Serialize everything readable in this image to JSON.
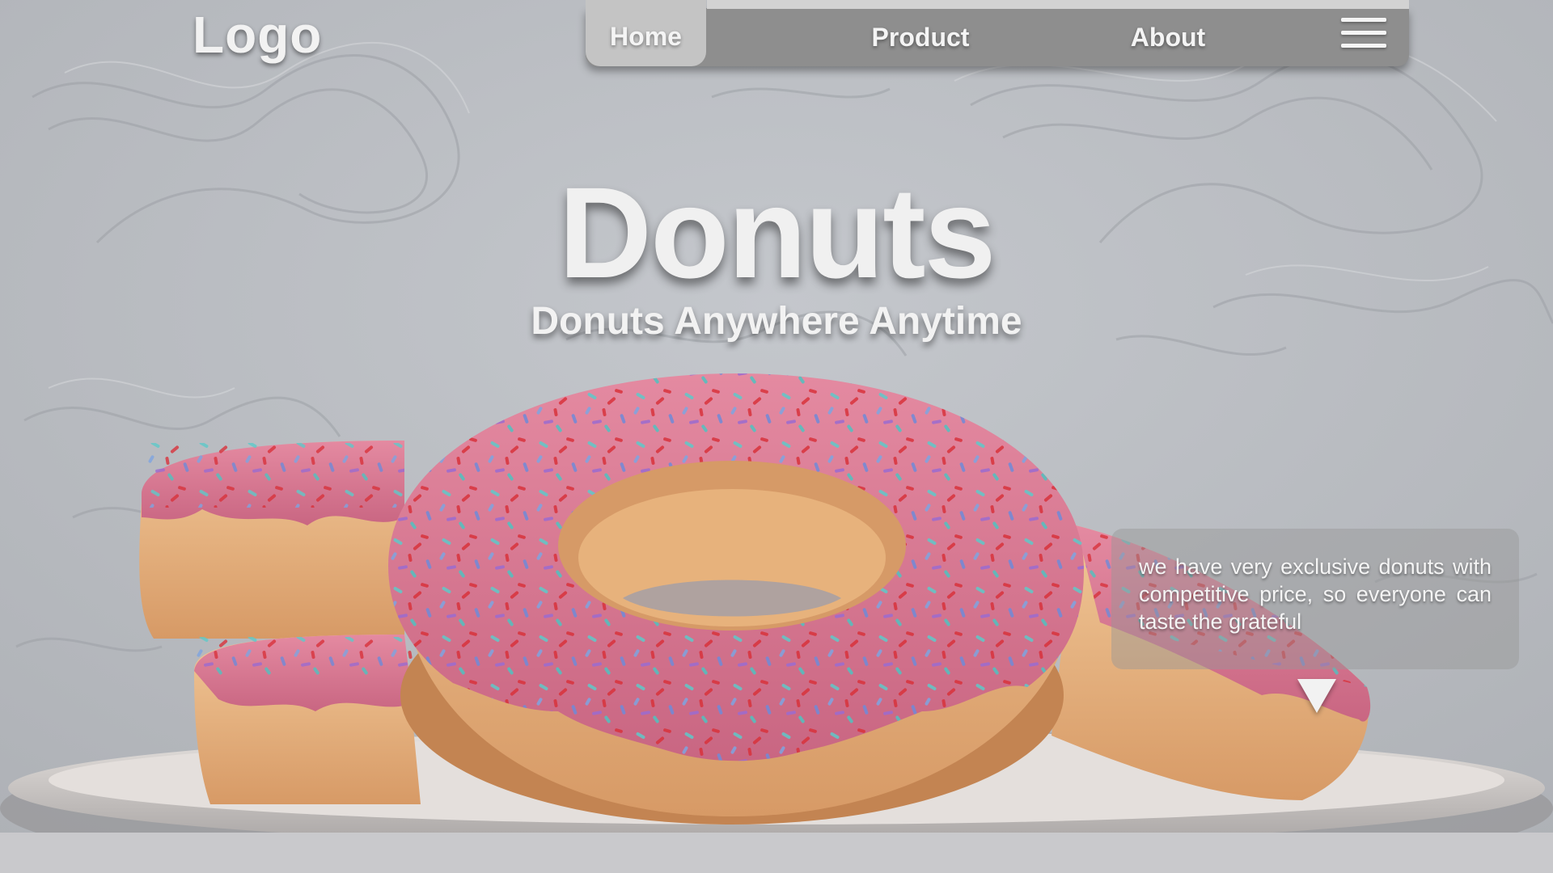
{
  "header": {
    "logo": "Logo"
  },
  "nav": {
    "items": [
      {
        "label": "Home",
        "active": true
      },
      {
        "label": "Product",
        "active": false
      },
      {
        "label": "About",
        "active": false
      }
    ],
    "menu_icon": "hamburger-menu-icon"
  },
  "hero": {
    "title": "Donuts",
    "subtitle": "Donuts Anywhere Anytime"
  },
  "info": {
    "text": "we have very exclusive donuts with competitive price, so everyone can taste the grateful",
    "arrow_icon": "down-triangle-icon"
  },
  "colors": {
    "background": "#b9bcc1",
    "nav_bar": "#8e8e8e",
    "nav_active": "#c4c4c4",
    "text": "#f2f2f2",
    "icing": "#d97a93",
    "dough": "#e9b98a",
    "plate": "#d7d2cf"
  }
}
